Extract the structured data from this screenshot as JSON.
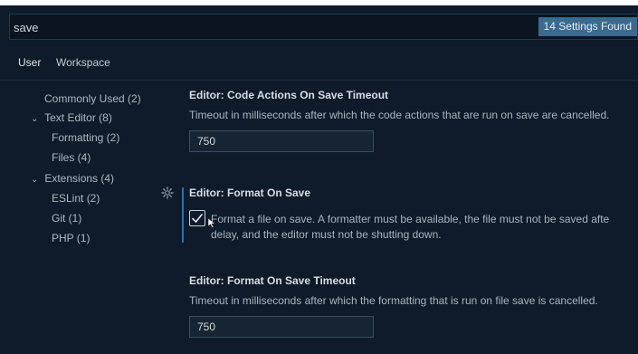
{
  "search": {
    "value": "save",
    "results_badge": "14 Settings Found"
  },
  "scope_tabs": {
    "user": "User",
    "workspace": "Workspace"
  },
  "toc": {
    "items": [
      {
        "label": "Commonly Used (2)",
        "level": 0,
        "expandable": false
      },
      {
        "label": "Text Editor (8)",
        "level": 0,
        "expandable": true
      },
      {
        "label": "Formatting (2)",
        "level": 1,
        "expandable": false
      },
      {
        "label": "Files (4)",
        "level": 1,
        "expandable": false
      },
      {
        "label": "Extensions (4)",
        "level": 0,
        "expandable": true
      },
      {
        "label": "ESLint (2)",
        "level": 1,
        "expandable": false
      },
      {
        "label": "Git (1)",
        "level": 1,
        "expandable": false
      },
      {
        "label": "PHP (1)",
        "level": 1,
        "expandable": false
      }
    ]
  },
  "settings": {
    "code_actions_timeout": {
      "title": "Editor: Code Actions On Save Timeout",
      "description": "Timeout in milliseconds after which the code actions that are run on save are cancelled.",
      "value": "750"
    },
    "format_on_save": {
      "title": "Editor: Format On Save",
      "description_line1": "Format a file on save. A formatter must be available, the file must not be saved afte",
      "description_line2": "delay, and the editor must not be shutting down.",
      "checked": true
    },
    "format_on_save_timeout": {
      "title": "Editor: Format On Save Timeout",
      "description": "Timeout in milliseconds after which the formatting that is run on file save is cancelled.",
      "value": "750"
    }
  },
  "colors": {
    "background": "#0f1b2a",
    "accent": "#2c6fb0",
    "badge": "#3a6a8e"
  }
}
